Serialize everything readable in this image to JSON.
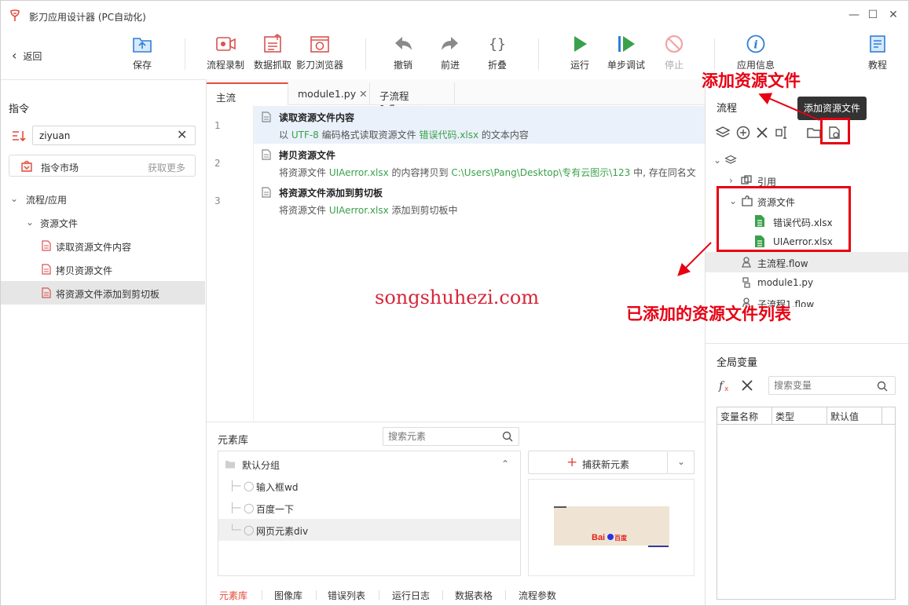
{
  "app": {
    "title": "影刀应用设计器 (PC自动化)"
  },
  "window": {
    "minimize": "—",
    "maximize": "☐",
    "close": "✕"
  },
  "toolbar": {
    "back": "返回",
    "save": "保存",
    "record": "流程录制",
    "capture": "数据抓取",
    "browser": "影刀浏览器",
    "undo": "撤销",
    "redo": "前进",
    "fold": "折叠",
    "run": "运行",
    "step_debug": "单步调试",
    "stop": "停止",
    "app_info": "应用信息",
    "tutorial": "教程"
  },
  "left_panel": {
    "heading": "指令",
    "search_value": "ziyuan",
    "market_label": "指令市场",
    "market_more": "获取更多",
    "tree": {
      "group": "流程/应用",
      "subgroup": "资源文件",
      "items": [
        "读取资源文件内容",
        "拷贝资源文件",
        "将资源文件添加到剪切板"
      ]
    }
  },
  "editor": {
    "tabs": [
      {
        "label": "主流程.flow"
      },
      {
        "label": "module1.py"
      },
      {
        "label": "子流程1.flow"
      }
    ],
    "steps": [
      {
        "no": "1",
        "title": "读取资源文件内容",
        "desc_parts": [
          "以 ",
          "UTF-8",
          " 编码格式读取资源文件 ",
          "错误代码.xlsx",
          " 的文本内容"
        ]
      },
      {
        "no": "2",
        "title": "拷贝资源文件",
        "desc_parts": [
          "将资源文件 ",
          "UIAerror.xlsx",
          " 的内容拷贝到 ",
          "C:\\Users\\Pang\\Desktop\\专有云图示\\123",
          " 中, 存在同名文"
        ]
      },
      {
        "no": "3",
        "title": "将资源文件添加到剪切板",
        "desc_parts": [
          "将资源文件 ",
          "UIAerror.xlsx",
          " 添加到剪切板中"
        ]
      }
    ],
    "watermark": "songshuhezi.com"
  },
  "element_library": {
    "title": "元素库",
    "search_placeholder": "搜索元素",
    "group": "默认分组",
    "items": [
      "输入框wd",
      "百度一下",
      "网页元素div"
    ],
    "capture_button": "捕获新元素",
    "bottom_tabs": [
      "元素库",
      "图像库",
      "错误列表",
      "运行日志",
      "数据表格",
      "流程参数"
    ]
  },
  "right_panel": {
    "flow_title": "流程",
    "tree": {
      "ref": "引用",
      "resource_folder": "资源文件",
      "resources": [
        "错误代码.xlsx",
        "UIAerror.xlsx"
      ],
      "files": [
        "主流程.flow",
        "module1.py",
        "子流程1.flow"
      ]
    },
    "vars_title": "全局变量",
    "var_search_placeholder": "搜索变量",
    "var_columns": [
      "变量名称",
      "类型",
      "默认值"
    ]
  },
  "tooltip": "添加资源文件",
  "annotations": {
    "add_resource": "添加资源文件",
    "added_list": "已添加的资源文件列表"
  },
  "colors": {
    "accent": "#e84c3d",
    "annotation": "#e60012",
    "green_text": "#3aa14a"
  }
}
